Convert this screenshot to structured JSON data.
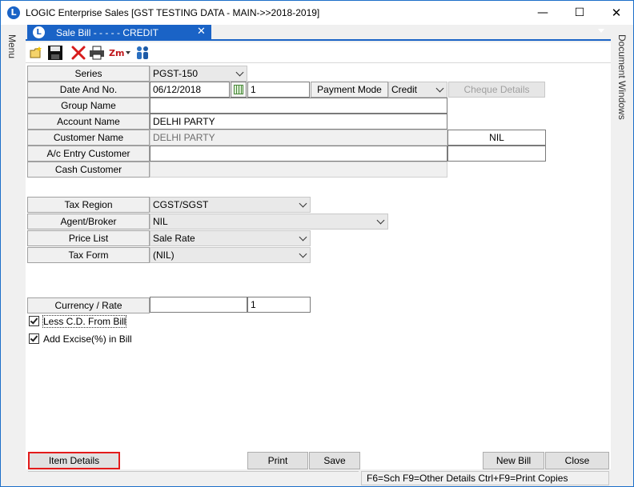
{
  "window": {
    "title": "LOGIC Enterprise Sales  [GST TESTING DATA - MAIN->>2018-2019]",
    "app_icon_letter": "L",
    "minimize_glyph": "—",
    "maximize_glyph": "☐",
    "close_glyph": "✕"
  },
  "side_menu": {
    "label": "Menu"
  },
  "side_docs": {
    "label": "Document Windows"
  },
  "doc_tab": {
    "label": "Sale Bill -  - - - - CREDIT",
    "close_glyph": "✕"
  },
  "toolbar": {
    "icons": [
      "new-folder-icon",
      "save-icon",
      "delete-icon",
      "print-icon",
      "zoom-icon",
      "users-icon"
    ]
  },
  "form": {
    "series": {
      "label": "Series",
      "value": "PGST-150"
    },
    "date_no": {
      "label": "Date And No.",
      "date": "06/12/2018",
      "number": "1"
    },
    "payment_mode": {
      "label": "Payment Mode",
      "value": "Credit"
    },
    "cheque_details": {
      "label": "Cheque Details"
    },
    "group_name": {
      "label": "Group Name",
      "value": ""
    },
    "account_name": {
      "label": "Account Name",
      "value": "DELHI PARTY"
    },
    "customer_name": {
      "label": "Customer Name",
      "value": "DELHI PARTY",
      "extra": "NIL"
    },
    "ac_entry_customer": {
      "label": "A/c Entry Customer",
      "value": "",
      "extra": ""
    },
    "cash_customer": {
      "label": "Cash Customer",
      "value": ""
    },
    "tax_region": {
      "label": "Tax Region",
      "value": "CGST/SGST"
    },
    "agent_broker": {
      "label": "Agent/Broker",
      "value": "NIL"
    },
    "price_list": {
      "label": "Price List",
      "value": "Sale Rate"
    },
    "tax_form": {
      "label": "Tax Form",
      "value": "(NIL)"
    },
    "currency_rate": {
      "label": "Currency / Rate",
      "currency": "",
      "rate": "1"
    },
    "less_cd": {
      "label": "Less C.D. From Bill",
      "checked": true
    },
    "add_excise": {
      "label": "Add Excise(%) in Bill",
      "checked": true
    }
  },
  "buttons": {
    "item_details": "Item Details",
    "print": "Print",
    "save": "Save",
    "new_bill": "New Bill",
    "close": "Close"
  },
  "status": {
    "hint": "F6=Sch  F9=Other Details  Ctrl+F9=Print Copies"
  },
  "colors": {
    "accent": "#1a63c6",
    "highlight_border": "#e31b1b"
  }
}
